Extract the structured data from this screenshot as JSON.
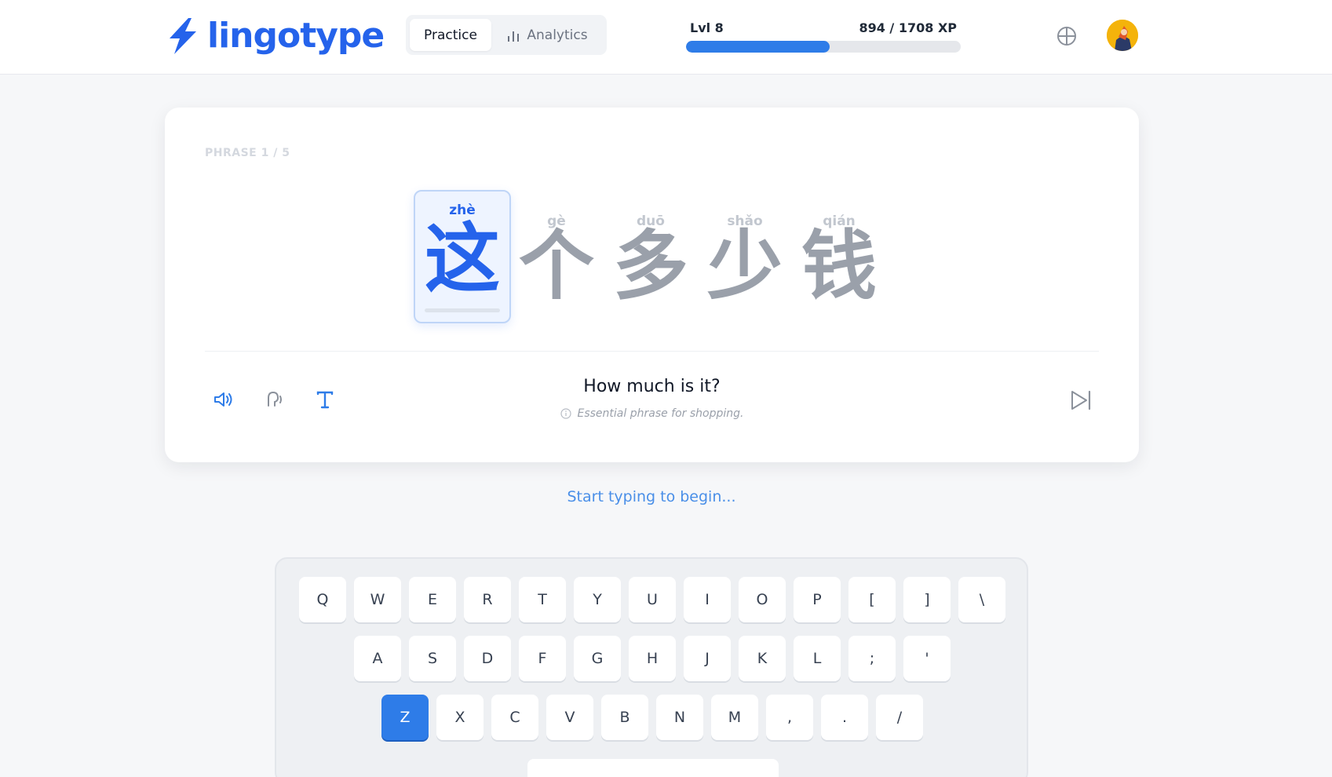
{
  "app": {
    "name": "lingotype",
    "accent": "#2563eb"
  },
  "nav": {
    "tabs": [
      {
        "label": "Practice",
        "active": true
      },
      {
        "label": "Analytics",
        "active": false
      }
    ]
  },
  "progress": {
    "level": "Lvl 8",
    "xp": "894 / 1708 XP",
    "fill": 0.523
  },
  "icons": {
    "globe": "globe-icon",
    "avatar": "avatar"
  },
  "phrase": {
    "counter": "PHRASE 1 / 5",
    "characters": [
      {
        "pinyin": "zhè",
        "hanzi": "这",
        "active": true
      },
      {
        "pinyin": "gè",
        "hanzi": "个",
        "active": false
      },
      {
        "pinyin": "duō",
        "hanzi": "多",
        "active": false
      },
      {
        "pinyin": "shǎo",
        "hanzi": "少",
        "active": false
      },
      {
        "pinyin": "qián",
        "hanzi": "钱",
        "active": false
      }
    ],
    "translation": "How much is it?",
    "note": "Essential phrase for shopping."
  },
  "hint": "Start typing to begin...",
  "keyboard": {
    "rows": [
      [
        "Q",
        "W",
        "E",
        "R",
        "T",
        "Y",
        "U",
        "I",
        "O",
        "P",
        "[",
        "]",
        "\\"
      ],
      [
        "A",
        "S",
        "D",
        "F",
        "G",
        "H",
        "J",
        "K",
        "L",
        ";",
        "'"
      ],
      [
        "Z",
        "X",
        "C",
        "V",
        "B",
        "N",
        "M",
        ",",
        ".",
        "/"
      ]
    ],
    "active_key": "Z"
  }
}
